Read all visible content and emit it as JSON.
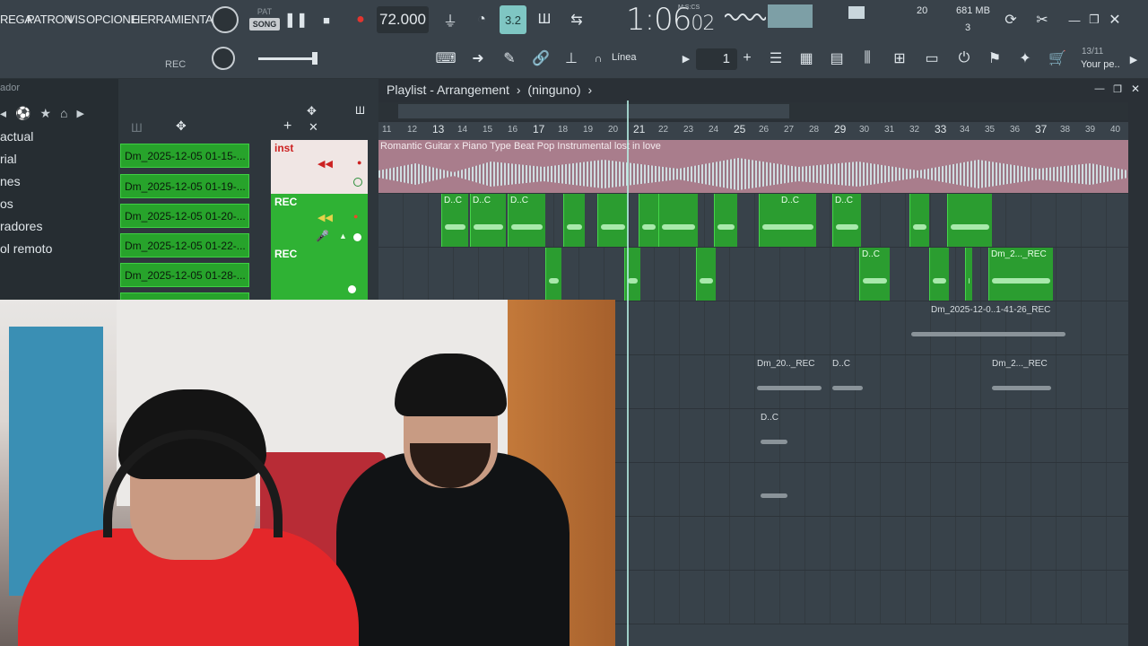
{
  "menu": {
    "items": [
      "REGA",
      "PATRON",
      "VIS",
      "OPCIONE",
      "HERRAMIENTA"
    ]
  },
  "transport": {
    "pat_label": "PAT",
    "song_label": "SONG",
    "tempo": "72.000",
    "snap_display": "3.2",
    "time_main": "1:06",
    "time_small": "02",
    "time_unit": "M:S:CS",
    "rec_label": "REC"
  },
  "status": {
    "cpu_value": "20",
    "memory": "681 MB",
    "voices": "3",
    "hint_date": "13/11",
    "hint_text": "Your pe.."
  },
  "toolbar2": {
    "snap_mode": "Línea",
    "pattern_num": "1"
  },
  "browser": {
    "header": "ador",
    "items": [
      "actual",
      "rial",
      "nes",
      "os",
      "radores",
      "ol remoto"
    ]
  },
  "clip_list": [
    "Dm_2025-12-05 01-15-...",
    "Dm_2025-12-05 01-19-...",
    "Dm_2025-12-05 01-20-...",
    "Dm_2025-12-05 01-22-...",
    "Dm_2025-12-05 01-28-..."
  ],
  "playlist": {
    "title": "Playlist - Arrangement",
    "pattern": "(ninguno)",
    "ruler_marks": [
      "11",
      "12",
      "13",
      "14",
      "15",
      "16",
      "17",
      "18",
      "19",
      "20",
      "21",
      "22",
      "23",
      "24",
      "25",
      "26",
      "27",
      "28",
      "29",
      "30",
      "31",
      "32",
      "33",
      "34",
      "35",
      "36",
      "37",
      "38",
      "39",
      "40"
    ],
    "tracks": [
      {
        "name": "inst"
      },
      {
        "name": "REC"
      },
      {
        "name": "REC"
      }
    ],
    "audio_clip_label": "Romantic Guitar x Piano Type Beat  Pop Instrumental  lost in love",
    "clip_labels": {
      "dc": "D..C",
      "rec_long": "Dm_2025-12-0..1-41-26_REC",
      "rec_short1": "Dm_20.._REC",
      "rec_short2": "Dm_2..._REC"
    }
  },
  "colors": {
    "toolbar_bg": "#39424a",
    "playlist_bg": "#38424a",
    "clip_green": "#2b9d30",
    "audio_clip": "#a97d8c"
  }
}
